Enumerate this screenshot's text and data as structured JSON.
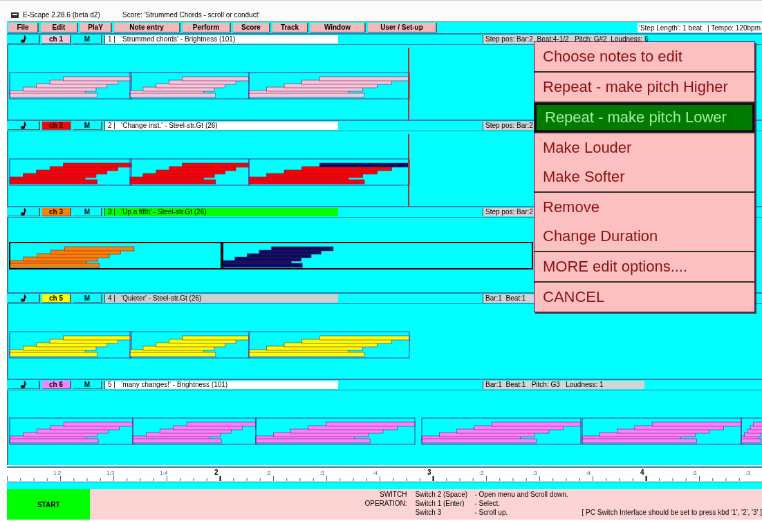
{
  "window": {
    "app": "E-Scape  2.28.6  (beta d2)",
    "title": "Score: 'Strummed Chords - scroll or conduct'"
  },
  "menu_bar": [
    "File",
    "Edit",
    "PlaY",
    "Note entry",
    "Perform",
    "Score",
    "Track",
    "Window",
    "User / Set-up"
  ],
  "info": {
    "step_length": "'Step Length':  1 beat",
    "tempo": "|  Tempo: 120bpm"
  },
  "tracks": [
    {
      "channel": "ch 1",
      "mute": "M",
      "name": "1 |   'Strummed chords' - Brightness (101)",
      "selected": false,
      "dimmed": false,
      "color": "#f8c4d8",
      "position": "Step pos: Bar:2  Beat:4-1/2   Pitch: G#2  Loudness: 6"
    },
    {
      "channel": "ch 2",
      "mute": "M",
      "name": "2 |   'Change inst.' - Steel-str.Gt (26)",
      "selected": false,
      "dimmed": false,
      "color": "#ff0000",
      "position": "Step pos: Bar:2"
    },
    {
      "channel": "ch 3",
      "mute": "M",
      "name": "3 |   'Up a fifth' - Steel-str.Gt (26)",
      "selected": true,
      "dimmed": false,
      "color": "#ff8000",
      "position": "Step pos: Bar:2"
    },
    {
      "channel": "ch 5",
      "mute": "M",
      "name": "4 |   'Quieter' - Steel-str.Gt (26)",
      "selected": false,
      "dimmed": true,
      "color": "#ffff00",
      "position": "Bar:1  Beat:1"
    },
    {
      "channel": "ch 6",
      "mute": "M",
      "name": "5 |   'many changes!' - Brightness (101)",
      "selected": false,
      "dimmed": false,
      "color": "#ff80ff",
      "position": "Bar:1  Beat:1   Pitch: G3   Loudness: 1"
    }
  ],
  "ruler": [
    {
      "label": "1:2",
      "kind": "beat"
    },
    {
      "label": "1:3",
      "kind": "beat"
    },
    {
      "label": "1:4",
      "kind": "beat"
    },
    {
      "label": "2",
      "kind": "bar"
    },
    {
      "label": ":2",
      "kind": "beat"
    },
    {
      "label": ":3",
      "kind": "beat"
    },
    {
      "label": ":4",
      "kind": "beat"
    },
    {
      "label": "3",
      "kind": "bar"
    },
    {
      "label": ":2",
      "kind": "beat"
    },
    {
      "label": ":3",
      "kind": "beat"
    },
    {
      "label": ":4",
      "kind": "beat"
    },
    {
      "label": "4",
      "kind": "bar"
    },
    {
      "label": ":2",
      "kind": "beat"
    },
    {
      "label": ":3",
      "kind": "beat"
    }
  ],
  "start_button": "START",
  "switch_help": {
    "rows": [
      {
        "label": "SWITCH",
        "switch": "Switch 2 (Space)",
        "action": "- Open menu and Scroll down."
      },
      {
        "label": "OPERATION:",
        "switch": "Switch 1 (Enter)",
        "action": "- Select."
      },
      {
        "switch": "Switch 3",
        "action": "- Scroll up.",
        "note": "[  PC Switch Interface should be set to press kbd '1', '2', '3'  ]"
      }
    ]
  },
  "edit_menu": {
    "groups": [
      [
        {
          "label": "Choose notes to edit",
          "selected": false
        }
      ],
      [
        {
          "label": "Repeat - make pitch Higher",
          "selected": false
        }
      ],
      [
        {
          "label": "Repeat - make pitch Lower",
          "selected": true
        }
      ],
      [
        {
          "label": "Make Louder",
          "selected": false
        },
        {
          "label": "Make Softer",
          "selected": false
        }
      ],
      [
        {
          "label": "Remove",
          "selected": false
        },
        {
          "label": "Change Duration",
          "selected": false
        }
      ],
      [
        {
          "label": "MORE edit options....",
          "selected": false
        }
      ],
      [
        {
          "label": "CANCEL",
          "selected": false
        }
      ]
    ]
  }
}
